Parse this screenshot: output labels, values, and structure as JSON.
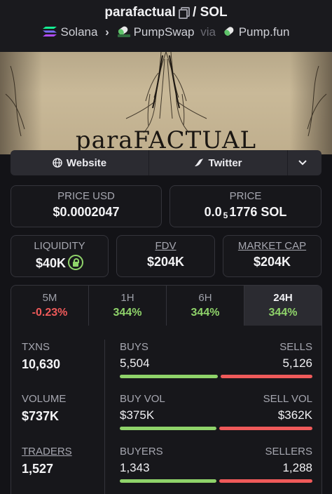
{
  "header": {
    "token_name": "parafactual",
    "pair_sep": "/",
    "quote": "SOL",
    "chain": "Solana",
    "dex": "PumpSwap",
    "via_label": "via",
    "launchpad": "Pump.fun",
    "chain_color": "#9945ff",
    "dex_color": "#8fd36a"
  },
  "banner": {
    "text": "paraFACTUAL"
  },
  "links": {
    "website": "Website",
    "twitter": "Twitter"
  },
  "stats": {
    "price_usd_label": "PRICE USD",
    "price_usd": "$0.0002047",
    "price_label": "PRICE",
    "price_prefix": "0.0",
    "price_zeros": "5",
    "price_rest": "1776 SOL",
    "liquidity_label": "LIQUIDITY",
    "liquidity": "$40K",
    "fdv_label": "FDV",
    "fdv": "$204K",
    "mcap_label": "MARKET CAP",
    "mcap": "$204K"
  },
  "tabs": [
    {
      "label": "5M",
      "value": "-0.23%",
      "trend": "down"
    },
    {
      "label": "1H",
      "value": "344%",
      "trend": "up"
    },
    {
      "label": "6H",
      "value": "344%",
      "trend": "up"
    },
    {
      "label": "24H",
      "value": "344%",
      "trend": "up",
      "active": true
    }
  ],
  "txns": {
    "txns_label": "TXNS",
    "txns": "10,630",
    "volume_label": "VOLUME",
    "volume": "$737K",
    "traders_label": "TRADERS",
    "traders": "1,527",
    "buys_label": "BUYS",
    "buys": "5,504",
    "sells_label": "SELLS",
    "sells": "5,126",
    "buyvol_label": "BUY VOL",
    "buyvol": "$375K",
    "sellvol_label": "SELL VOL",
    "sellvol": "$362K",
    "buyers_label": "BUYERS",
    "buyers": "1,343",
    "sellers_label": "SELLERS",
    "sellers": "1,288",
    "buy_ratio_txns": 0.518,
    "buy_ratio_vol": 0.509,
    "buy_ratio_traders": 0.51
  }
}
